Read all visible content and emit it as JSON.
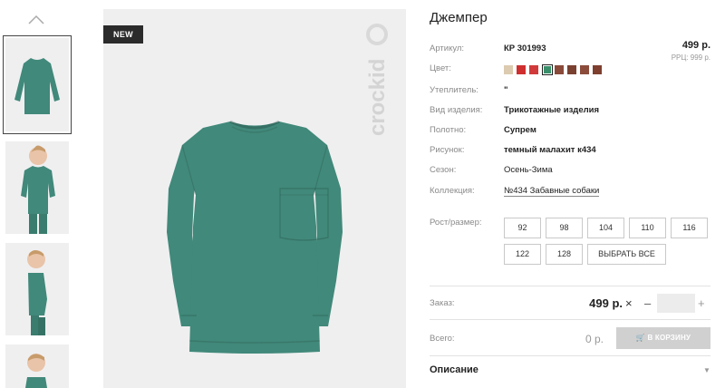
{
  "badge": "NEW",
  "brand": "crockid",
  "product": {
    "title": "Джемпер",
    "price": "499 р.",
    "rrp": "РРЦ: 999 р."
  },
  "attributes": [
    {
      "label": "Артикул:",
      "value": "КР 301993",
      "bold": true
    },
    {
      "label": "Цвет:",
      "value": ""
    },
    {
      "label": "Утеплитель:",
      "value": "\"",
      "bold": true
    },
    {
      "label": "Вид изделия:",
      "value": "Трикотажные изделия",
      "bold": true
    },
    {
      "label": "Полотно:",
      "value": "Супрем",
      "bold": true
    },
    {
      "label": "Рисунок:",
      "value": "темный малахит к434",
      "bold": true
    },
    {
      "label": "Сезон:",
      "value": "Осень-Зима",
      "bold": false
    },
    {
      "label": "Коллекция:",
      "value": "№434 Забавные собаки",
      "bold": false
    }
  ],
  "colors": [
    "#dccbb0",
    "#cf2f2f",
    "#d13a3a",
    "#3a8f6b",
    "#8a4a3a",
    "#7a4030",
    "#8c4c3c",
    "#7e3f2f"
  ],
  "active_color_index": 3,
  "size_label": "Рост/размер:",
  "sizes": [
    "92",
    "98",
    "104",
    "110",
    "116",
    "122",
    "128"
  ],
  "select_all": "ВЫБРАТЬ ВСЕ",
  "order": {
    "label": "Заказ:",
    "price": "499 р.",
    "times": "×",
    "minus": "–",
    "plus": "+",
    "qty": ""
  },
  "total": {
    "label": "Всего:",
    "value": "0 р.",
    "cart_button": "В КОРЗИНУ"
  },
  "description": "Описание",
  "shirt_color": "#41897a"
}
